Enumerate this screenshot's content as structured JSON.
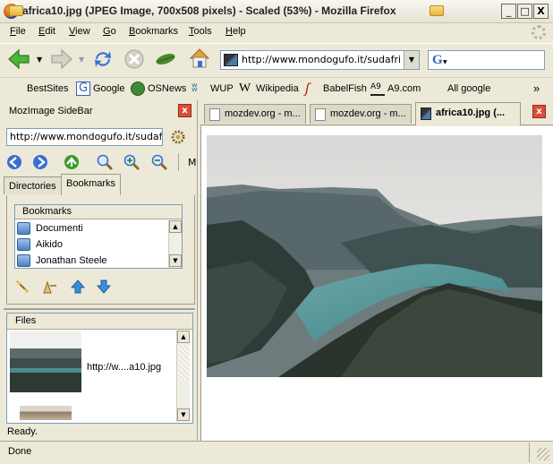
{
  "window": {
    "title": "africa10.jpg (JPEG Image, 700x508 pixels) - Scaled (53%) - Mozilla Firefox",
    "minimize": "_",
    "maximize": "□",
    "close": "X"
  },
  "menu": {
    "items": [
      {
        "key": "F",
        "rest": "ile"
      },
      {
        "key": "E",
        "rest": "dit"
      },
      {
        "key": "V",
        "rest": "iew"
      },
      {
        "key": "G",
        "rest": "o"
      },
      {
        "key": "B",
        "rest": "ookmarks"
      },
      {
        "key": "T",
        "rest": "ools"
      },
      {
        "key": "H",
        "rest": "elp"
      }
    ]
  },
  "nav": {
    "url": "http://www.mondogufo.it/sudafrica2",
    "search_engine_glyph": "G",
    "search_value": ""
  },
  "bookmarks_toolbar": {
    "items": [
      "BestSites",
      "Google",
      "OSNews",
      "WUP",
      "Wikipedia",
      "BabelFish",
      "A9.com",
      "All google"
    ],
    "overflow": "»"
  },
  "sidebar": {
    "title": "MozImage SideBar",
    "close": "x",
    "url": "http://www.mondogufo.it/sudafric",
    "mode_label": "M",
    "tabs": [
      "Directories",
      "Bookmarks"
    ],
    "active_tab": "Bookmarks",
    "bookmarks": {
      "header": "Bookmarks",
      "items": [
        "Documenti",
        "Aikido",
        "Jonathan Steele"
      ]
    },
    "files": {
      "header": "Files",
      "items": [
        {
          "label": "http://w....a10.jpg"
        }
      ]
    },
    "status": "Ready."
  },
  "tabs": {
    "items": [
      {
        "label": "mozdev.org - m..."
      },
      {
        "label": "mozdev.org - m..."
      },
      {
        "label": "africa10.jpg (..."
      }
    ],
    "active_index": 2,
    "close": "x"
  },
  "status": {
    "text": "Done"
  },
  "colors": {
    "chrome": "#ece9d8",
    "accent_blue": "#3a6fd1",
    "close_red": "#d8503a"
  }
}
